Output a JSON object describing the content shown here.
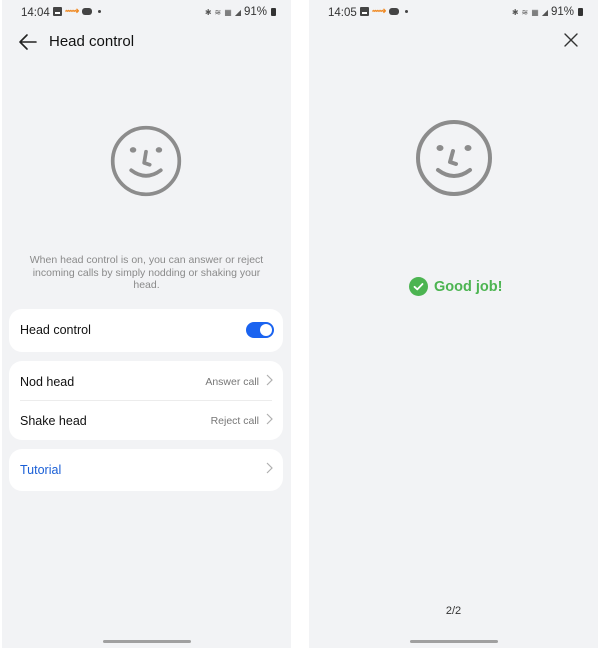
{
  "left_screen": {
    "status_bar": {
      "time": "14:04",
      "left_icons": [
        "gallery-icon",
        "orange-app-icon",
        "game-icon",
        "notification-dot-icon"
      ],
      "right_icons": [
        "bluetooth-icon",
        "wifi-icon",
        "volte-icon",
        "signal-icon"
      ],
      "battery": "91%"
    },
    "appbar": {
      "back_icon": "arrow-left-icon",
      "title": "Head control"
    },
    "illustration_icon": "smiley-face-icon",
    "description": "When head control is on, you can answer or reject incoming calls by simply nodding or shaking your head.",
    "toggle_card": {
      "label": "Head control",
      "enabled": true
    },
    "actions_card": {
      "rows": [
        {
          "label": "Nod head",
          "value": "Answer call"
        },
        {
          "label": "Shake head",
          "value": "Reject call"
        }
      ]
    },
    "tutorial": {
      "label": "Tutorial"
    }
  },
  "right_screen": {
    "status_bar": {
      "time": "14:05",
      "left_icons": [
        "gallery-icon",
        "orange-app-icon",
        "game-icon",
        "notification-dot-icon"
      ],
      "right_icons": [
        "bluetooth-icon",
        "wifi-icon",
        "volte-icon",
        "signal-icon"
      ],
      "battery": "91%"
    },
    "close_icon": "close-icon",
    "illustration_icon": "smiley-face-icon",
    "result": {
      "icon": "check-circle-icon",
      "text": "Good job!"
    },
    "pager": "2/2"
  },
  "colors": {
    "background": "#f2f3f5",
    "card": "#ffffff",
    "accent_blue": "#1a63f0",
    "link_blue": "#1a5fd6",
    "success_green": "#4cb451",
    "icon_gray": "#8c8c8c"
  }
}
